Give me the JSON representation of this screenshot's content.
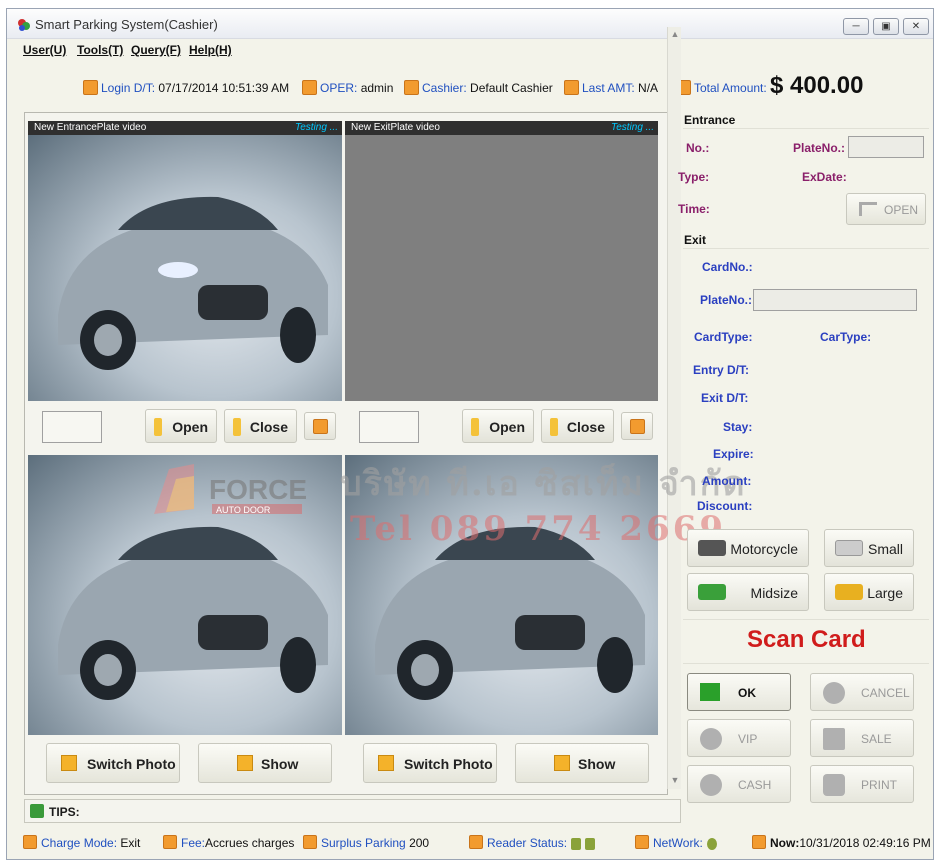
{
  "window": {
    "title": "Smart Parking System(Cashier)",
    "controls": [
      "minimize",
      "restore",
      "close"
    ]
  },
  "menu": {
    "items": [
      "User(U)",
      "Tools(T)",
      "Query(F)",
      "Help(H)"
    ]
  },
  "info": {
    "login_label": "Login D/T:",
    "login_value": "07/17/2014 10:51:39 AM",
    "oper_label": "OPER:",
    "oper_value": "admin",
    "cashier_label": "Cashier:",
    "cashier_value": "Default Cashier",
    "last_amt_label": "Last AMT:",
    "last_amt_value": "N/A",
    "total_label": "Total Amount:",
    "total_value": "$ 400.00"
  },
  "video": {
    "entrance_title": "New EntrancePlate video",
    "exit_title": "New ExitPlate video",
    "status": "Testing ...",
    "open_label": "Open",
    "close_label": "Close",
    "switch_photo_label": "Switch Photo",
    "show_label": "Show"
  },
  "watermark": {
    "logo_text": "FORCE",
    "logo_sub": "AUTO DOOR",
    "company": "บริษัท ที.เอ ซิสเท็ม จำกัด",
    "phone": "Tel 089 774 2669"
  },
  "entrance": {
    "heading": "Entrance",
    "no_label": "No.:",
    "plate_label": "PlateNo.:",
    "type_label": "Type:",
    "exdate_label": "ExDate:",
    "time_label": "Time:",
    "open_label": "OPEN"
  },
  "exit": {
    "heading": "Exit",
    "card_no_label": "CardNo.:",
    "plate_label": "PlateNo.:",
    "card_type_label": "CardType:",
    "car_type_label": "CarType:",
    "entry_label": "Entry D/T:",
    "exit_label": "Exit D/T:",
    "stay_label": "Stay:",
    "expire_label": "Expire:",
    "amount_label": "Amount:",
    "discount_label": "Discount:"
  },
  "vehicles": {
    "motorcycle": "Motorcycle",
    "small": "Small",
    "midsize": "Midsize",
    "large": "Large"
  },
  "scan_card": "Scan Card",
  "actions": {
    "ok": "OK",
    "cancel": "CANCEL",
    "vip": "VIP",
    "sale": "SALE",
    "cash": "CASH",
    "print": "PRINT"
  },
  "tips": {
    "label": "TIPS:"
  },
  "status": {
    "charge_mode_label": "Charge Mode:",
    "charge_mode_value": "Exit",
    "fee_label": "Fee:",
    "fee_value": "Accrues charges",
    "surplus_label": "Surplus Parking",
    "surplus_value": "200",
    "reader_label": "Reader Status:",
    "network_label": "NetWork:",
    "now_label": "Now:",
    "now_value": "10/31/2018 02:49:16 PM"
  },
  "colors": {
    "accent_orange": "#f29b2f",
    "label_purple": "#8a1f6a",
    "label_blue": "#2a3fc0",
    "scan_red": "#d01c1c"
  }
}
